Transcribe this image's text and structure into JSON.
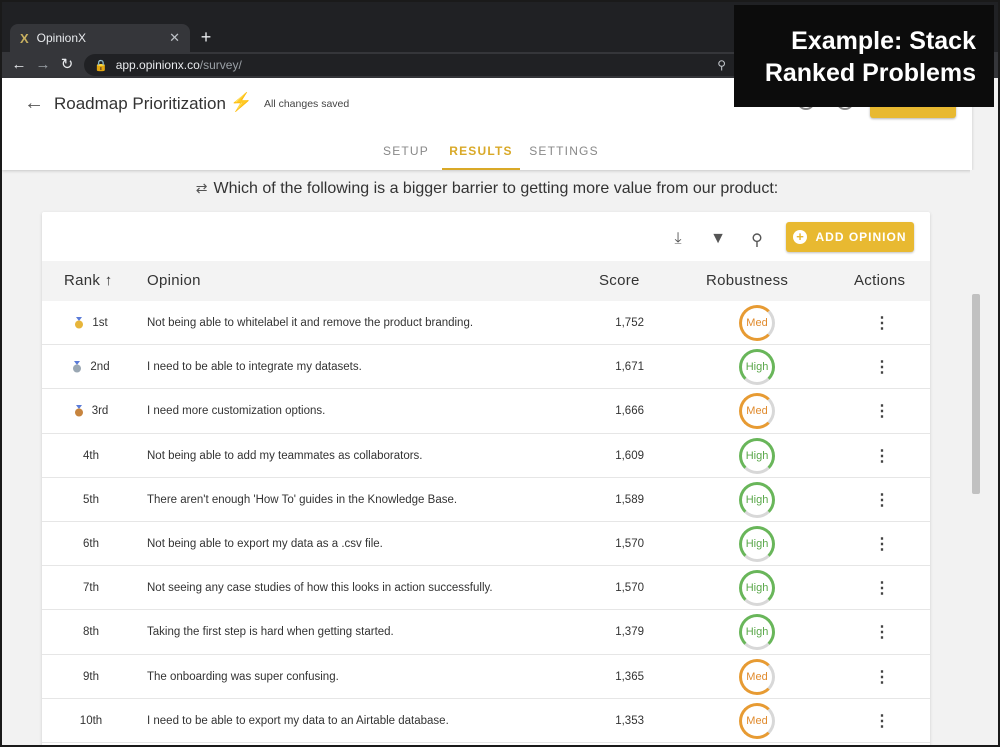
{
  "callout": {
    "line1": "Example: Stack",
    "line2": "Ranked Problems"
  },
  "browser": {
    "tab_title": "OpinionX",
    "tab_close": "✕",
    "new_tab": "+",
    "url_host": "app.opinionx.co",
    "url_path": "/survey/"
  },
  "header": {
    "title": "Roadmap Prioritization",
    "saved_status": "All changes saved",
    "tabs": [
      {
        "label": "SETUP"
      },
      {
        "label": "RESULTS"
      },
      {
        "label": "SETTINGS"
      }
    ]
  },
  "question": "Which of the following is a bigger barrier to getting more value from our product:",
  "toolbar": {
    "add_label": "ADD OPINION"
  },
  "table": {
    "headers": {
      "rank": "Rank",
      "rank_sort": "↑",
      "opinion": "Opinion",
      "score": "Score",
      "robustness": "Robustness",
      "actions": "Actions"
    },
    "rows": [
      {
        "rank": "1st",
        "medal": "gold",
        "opinion": "Not being able to whitelabel it and remove the product branding.",
        "score": "1,752",
        "robustness": "Med"
      },
      {
        "rank": "2nd",
        "medal": "silver",
        "opinion": "I need to be able to integrate my datasets.",
        "score": "1,671",
        "robustness": "High"
      },
      {
        "rank": "3rd",
        "medal": "bronze",
        "opinion": "I need more customization options.",
        "score": "1,666",
        "robustness": "Med"
      },
      {
        "rank": "4th",
        "medal": "",
        "opinion": "Not being able to add my teammates as collaborators.",
        "score": "1,609",
        "robustness": "High"
      },
      {
        "rank": "5th",
        "medal": "",
        "opinion": "There aren't enough 'How To' guides in the Knowledge Base.",
        "score": "1,589",
        "robustness": "High"
      },
      {
        "rank": "6th",
        "medal": "",
        "opinion": "Not being able to export my data as a .csv file.",
        "score": "1,570",
        "robustness": "High"
      },
      {
        "rank": "7th",
        "medal": "",
        "opinion": "Not seeing any case studies of how this looks in action successfully.",
        "score": "1,570",
        "robustness": "High"
      },
      {
        "rank": "8th",
        "medal": "",
        "opinion": "Taking the first step is hard when getting started.",
        "score": "1,379",
        "robustness": "High"
      },
      {
        "rank": "9th",
        "medal": "",
        "opinion": "The onboarding was super confusing.",
        "score": "1,365",
        "robustness": "Med"
      },
      {
        "rank": "10th",
        "medal": "",
        "opinion": "I need to be able to export my data to an Airtable database.",
        "score": "1,353",
        "robustness": "Med"
      }
    ]
  },
  "colors": {
    "accent": "#e8b931",
    "med": "#e79b33",
    "high": "#69b65a",
    "callout_bg": "#0c0c0c"
  }
}
